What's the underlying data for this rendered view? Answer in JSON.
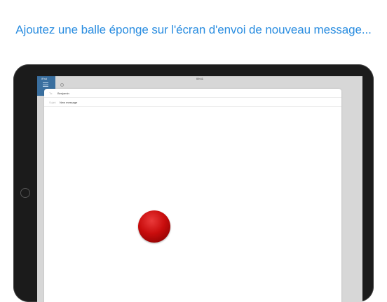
{
  "headline": "Ajoutez une balle éponge sur l'écran d'envoi de nouveau message...",
  "status_bar": {
    "left": "iPad",
    "time": "09:41"
  },
  "compose": {
    "to_label": "To:",
    "to_value": "Benjamin",
    "subject_label": "Sujet:",
    "subject_value": "New message"
  },
  "ball": {
    "color": "#c90d0d",
    "label": "sponge-ball"
  },
  "colors": {
    "headline": "#2a8de0",
    "tablet_frame": "#1b1b1b",
    "sidebar_accent": "#3a6f9f"
  }
}
